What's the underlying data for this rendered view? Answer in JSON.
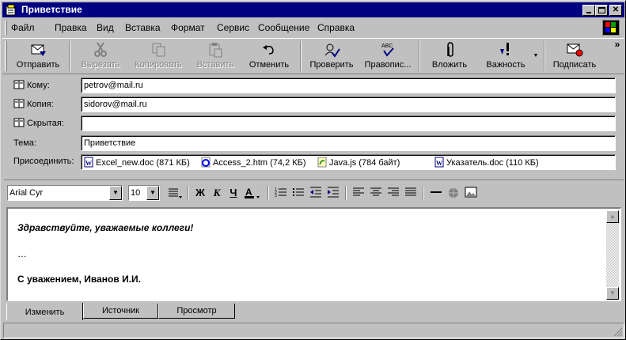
{
  "window": {
    "title": "Приветствие"
  },
  "menu": [
    "Файл",
    "Правка",
    "Вид",
    "Вставка",
    "Формат",
    "Сервис",
    "Сообщение",
    "Справка"
  ],
  "toolbar": {
    "send": "Отправить",
    "cut": "Вырезать",
    "copy": "Копировать",
    "paste": "Вставить",
    "undo": "Отменить",
    "check": "Проверить",
    "spelling": "Правопис...",
    "attach": "Вложить",
    "priority": "Важность",
    "sign": "Подписать",
    "more": "»"
  },
  "headers": {
    "to_label": "Кому:",
    "to_value": "petrov@mail.ru",
    "cc_label": "Копия:",
    "cc_value": "sidorov@mail.ru",
    "bcc_label": "Скрытая:",
    "bcc_value": "",
    "subject_label": "Тема:",
    "subject_value": "Приветствие",
    "attach_label": "Присоединить:"
  },
  "attachments": [
    {
      "name": "Excel_new.doc (871 КБ)",
      "icon": "word-doc-icon"
    },
    {
      "name": "Access_2.htm (74,2 КБ)",
      "icon": "ie-html-icon"
    },
    {
      "name": "Java.js (784 байт)",
      "icon": "script-file-icon"
    },
    {
      "name": "Указатель.doc (110 КБ)",
      "icon": "word-doc-icon"
    }
  ],
  "format": {
    "font": "Arial Cyr",
    "size": "10"
  },
  "body": {
    "line1": "Здравствуйте, уважаемые коллеги!",
    "line2": "…",
    "line3": "С уважением, Иванов И.И."
  },
  "tabs": [
    "Изменить",
    "Источник",
    "Просмотр"
  ]
}
